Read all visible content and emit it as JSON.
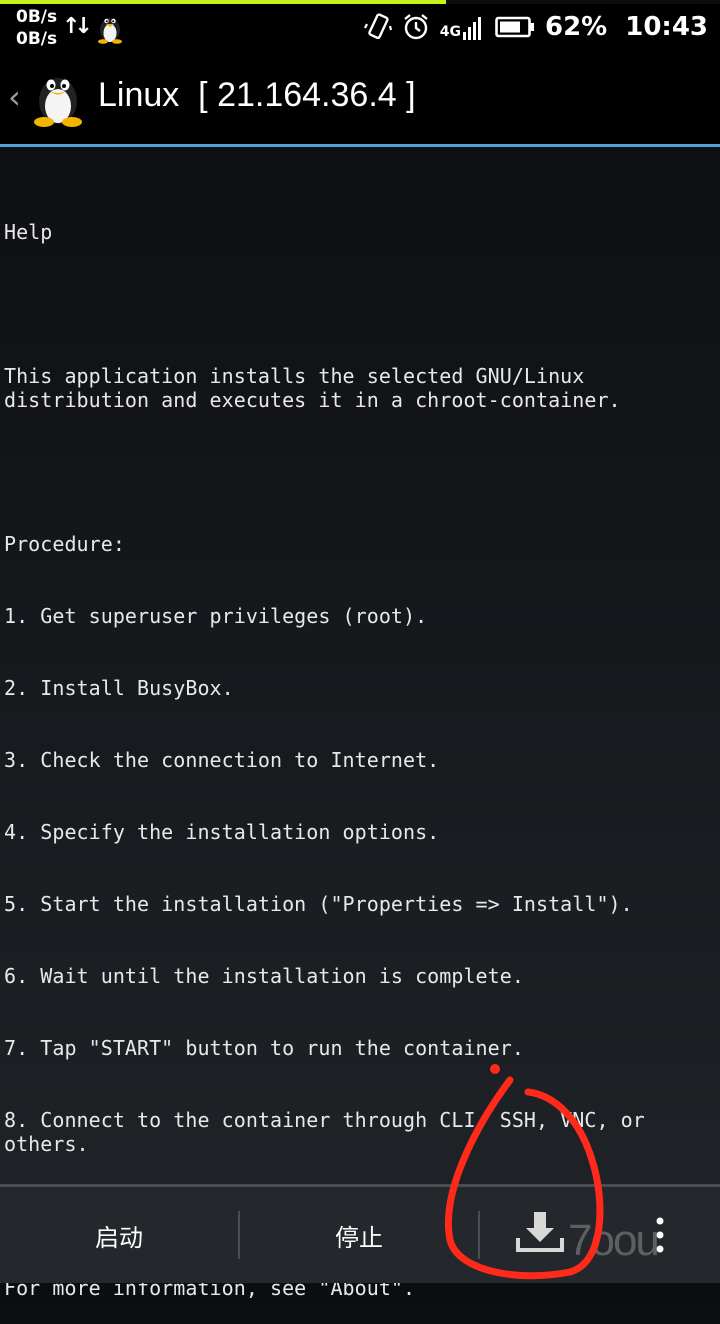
{
  "status_bar": {
    "upload_speed": "0B/s",
    "download_speed": "0B/s",
    "network_type": "4G",
    "battery_percent": "62%",
    "time": "10:43"
  },
  "action_bar": {
    "title": "Linux  [ 21.164.36.4 ]",
    "back_icon": "chevron-left-icon",
    "app_icon": "tux-penguin-icon"
  },
  "content": {
    "heading": "Help",
    "intro": "This application installs the selected GNU/Linux distribution and executes it in a chroot-container.",
    "procedure_label": "Procedure:",
    "steps": [
      "1. Get superuser privileges (root).",
      "2. Install BusyBox.",
      "3. Check the connection to Internet.",
      "4. Specify the installation options.",
      "5. Start the installation (\"Properties => Install\").",
      "6. Wait until the installation is complete.",
      "7. Tap \"START\" button to run the container.",
      "8. Connect to the container through CLI, SSH, VNC, or others."
    ],
    "footer": "For more information, see \"About\"."
  },
  "toolbar": {
    "start_label": "启动",
    "stop_label": "停止",
    "install_icon": "download-tray-icon",
    "overflow_icon": "more-vertical-icon"
  },
  "colors": {
    "accent": "#4ea3d6",
    "progress": "#c6f21e",
    "annotation": "#ff2a1a"
  }
}
